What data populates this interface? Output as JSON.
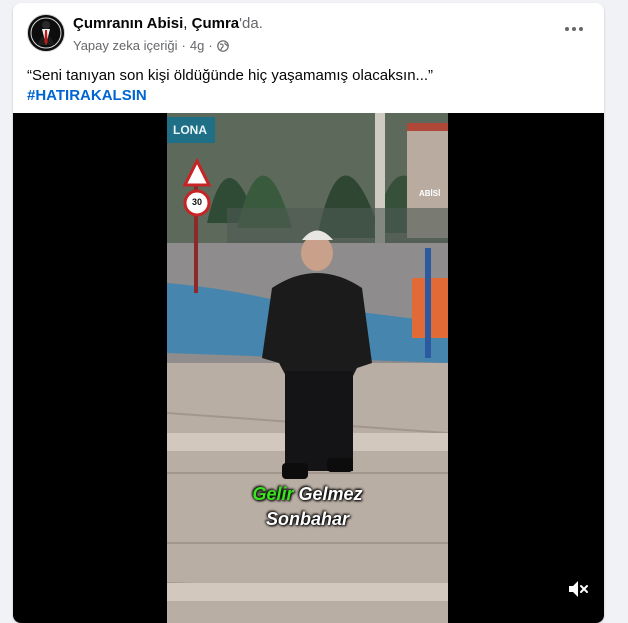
{
  "post": {
    "author_name": "Çumranın Abisi",
    "location_separator": ", ",
    "location": "Çumra",
    "location_suffix": "'da.",
    "ai_label": "Yapay zeka içeriği",
    "dot": "·",
    "time": "4g",
    "text": "“Seni tanıyan son kişi öldüğünde hiç yaşamamış olacaksın...”",
    "hashtag": "#HATIRAKALSIN"
  },
  "video": {
    "sign_text": "LONA",
    "speed_limit": "30",
    "watermark": "ABİSİ",
    "caption_green": "Gelir",
    "caption_rest": " Gelmez",
    "caption_line2": "Sonbahar"
  },
  "colors": {
    "background": "#f0f2f5",
    "link_blue": "#0064d1",
    "caption_green": "#39e61d",
    "secondary_text": "#65676b"
  },
  "icons": {
    "more": "more-horizontal-icon",
    "globe": "globe-icon",
    "mute": "speaker-muted-icon"
  }
}
